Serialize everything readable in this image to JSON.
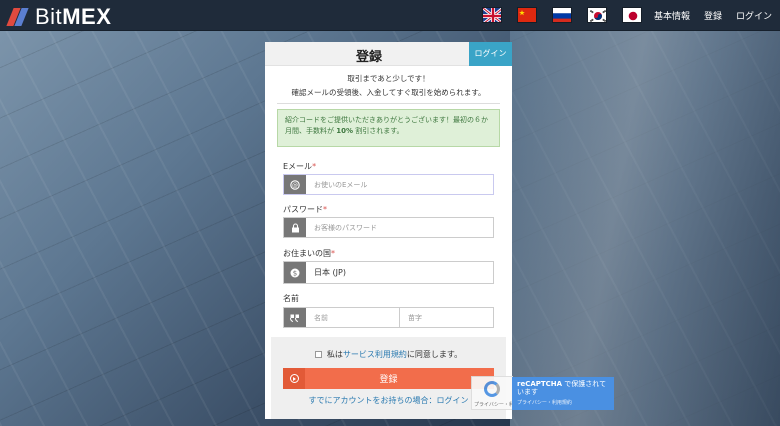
{
  "header": {
    "logo_bit": "Bit",
    "logo_mex": "MEX",
    "flags": [
      "uk-flag",
      "china-flag",
      "russia-flag",
      "korea-flag",
      "japan-flag"
    ],
    "nav": [
      "基本情報",
      "登録",
      "ログイン"
    ]
  },
  "form": {
    "title": "登録",
    "login_tab": "ログイン",
    "subtitle1": "取引まであと少しです！",
    "subtitle2": "確認メールの受領後、入金してすぐ取引を始められます。",
    "notice_pre": "紹介コードをご提供いただきありがとうございます！最初の６か月間、手数料が ",
    "notice_bold": "10%",
    "notice_post": " 割引されます。",
    "email_label": "Eメール",
    "email_placeholder": "お使いのEメール",
    "password_label": "パスワード",
    "password_placeholder": "お客様のパスワード",
    "country_label": "お住まいの国",
    "country_value": "日本 (JP)",
    "name_label": "名前",
    "first_name_placeholder": "名前",
    "last_name_placeholder": "苗字",
    "required_mark": "*",
    "agree_pre": "私は",
    "agree_link": "サービス利用規約",
    "agree_post": "に同意します。",
    "submit_label": "登録",
    "already_text": "すでにアカウントをお持ちの場合：ログイン"
  },
  "recaptcha": {
    "title": "reCAPTCHA",
    "title_rest": " で保護されています",
    "links": "プライバシー・利用規約",
    "badge_text": "プライバシー・利用規約"
  },
  "colors": {
    "topbar": "#1f2b3a",
    "accent_orange": "#f26d4b",
    "login_tab": "#3aa4c7",
    "notice_bg": "#dff0d8",
    "recaptcha_blue": "#4a90e2"
  }
}
